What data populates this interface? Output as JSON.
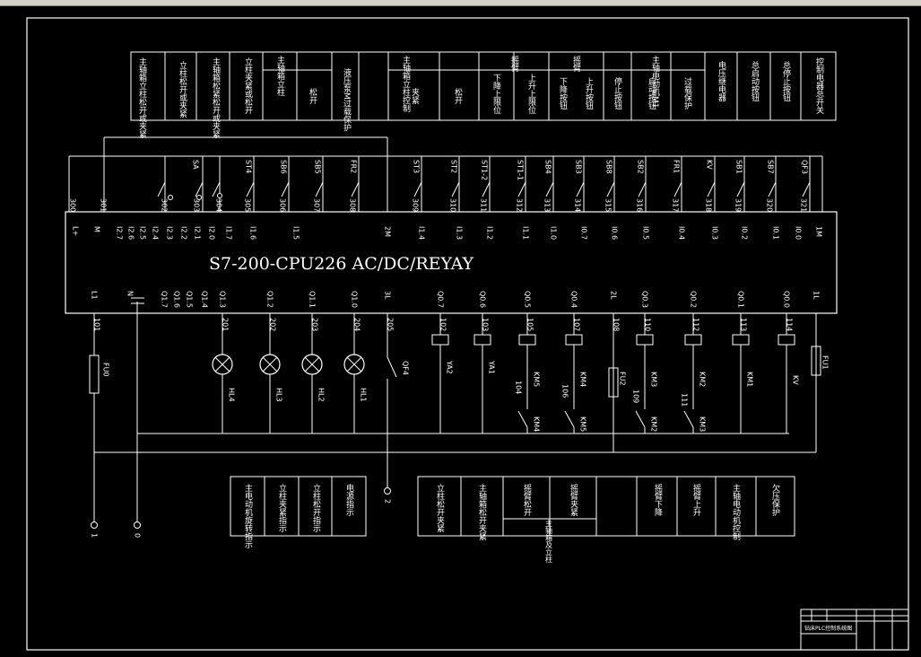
{
  "plc_model": "S7-200-CPU226 AC/DC/REYAY",
  "top_headers": [
    "主轴箱立柱松开或夹紧",
    "立柱松开或夹紧",
    "主轴箱松紧松开或夹紧",
    "立柱夹紧或松开",
    "主轴箱立柱",
    "松开",
    "液压泵M过载保护",
    "夹紧",
    "松开",
    "主轴箱立柱控制",
    "下降上限位",
    "上升上限位",
    "摇臂",
    "下降按钮",
    "上升按钮",
    "摇臂",
    "停止按钮",
    "启动按钮",
    "过载保护",
    "主轴电动机M1",
    "电压继电器",
    "总启动按钮",
    "总停止按钮",
    "控制电器总开关"
  ],
  "input_devices": [
    "SA",
    "ST4",
    "SB6",
    "SB5",
    "FR2",
    "ST3",
    "ST2",
    "ST1-2",
    "ST1-1",
    "SB4",
    "SB3",
    "SB8",
    "SB2",
    "FR1",
    "KV",
    "SB1",
    "SB7",
    "QF3"
  ],
  "input_wires": [
    "300",
    "301",
    "302",
    "303",
    "304",
    "305",
    "306",
    "307",
    "308",
    "309",
    "310",
    "311",
    "312",
    "313",
    "314",
    "315",
    "316",
    "317",
    "318",
    "319",
    "320",
    "321"
  ],
  "input_terminals": [
    "L+",
    "M",
    "I2.7",
    "I2.6",
    "I2.5",
    "I2.4",
    "I2.3",
    "I2.2",
    "I2.1",
    "I2.0",
    "I1.7",
    "I1.6",
    "I1.5",
    "2M",
    "I1.4",
    "I1.3",
    "I1.2",
    "I1.1",
    "I1.0",
    "I0.7",
    "I0.6",
    "I0.5",
    "I0.4",
    "I0.3",
    "I0.2",
    "I0.1",
    "I0.0",
    "1M"
  ],
  "output_terminals": [
    "L1",
    "N",
    "Q1.7",
    "Q1.6",
    "Q1.5",
    "Q1.4",
    "Q1.3",
    "Q1.2",
    "Q1.1",
    "Q1.0",
    "3L",
    "Q0.7",
    "Q0.6",
    "Q0.5",
    "Q0.4",
    "2L",
    "Q0.3",
    "Q0.2",
    "Q0.1",
    "Q0.0",
    "1L"
  ],
  "output_wires": [
    "101",
    "201",
    "202",
    "203",
    "204",
    "205",
    "102",
    "103",
    "105",
    "107",
    "108",
    "110",
    "112",
    "113",
    "114"
  ],
  "output_loads": [
    "FU0",
    "HL4",
    "HL3",
    "HL2",
    "HL1",
    "QF4",
    "YA2",
    "YA1",
    "KM5",
    "KM4",
    "FU2",
    "KM3",
    "KM2",
    "KM1",
    "KV",
    "FU1"
  ],
  "interlocks": [
    "KM4",
    "KM5",
    "KM2",
    "KM3"
  ],
  "interlock_wires": [
    "104",
    "106",
    "109",
    "111"
  ],
  "bottom_left": [
    "主电动机旋转指示",
    "立柱夹紧指示",
    "立柱松开指示",
    "电源指示"
  ],
  "bottom_right": [
    "立柱松开夹紧",
    "主轴箱松开夹紧",
    "摇臂松开",
    "摇臂夹紧",
    "主轴箱及立柱",
    "摇臂下降",
    "摇臂上升",
    "主轴电动机控制",
    "欠压保护"
  ],
  "terminals": [
    "1",
    "0",
    "2"
  ],
  "title_block": "钻床PLC控制系统图"
}
